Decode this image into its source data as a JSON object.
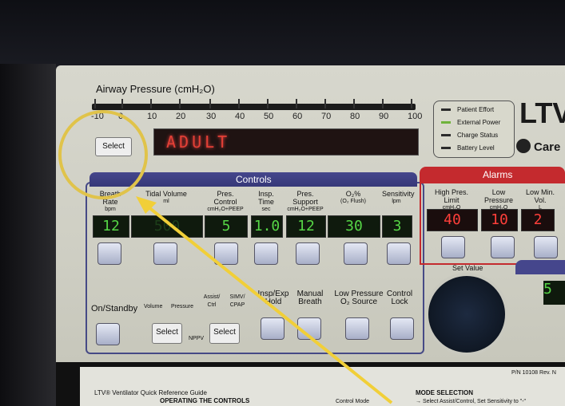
{
  "airway": {
    "title": "Airway Pressure (cmH₂O)",
    "scale": [
      "-10",
      "0",
      "10",
      "20",
      "30",
      "40",
      "50",
      "60",
      "70",
      "80",
      "90",
      "100"
    ]
  },
  "display_text": "ADULT",
  "select_label": "Select",
  "status": [
    "Patient Effort",
    "External Power",
    "Charge Status",
    "Battery Level"
  ],
  "brand": {
    "name": "LTV",
    "sub": "Care"
  },
  "sections": {
    "controls": "Controls",
    "alarms": "Alarms"
  },
  "controls": [
    {
      "label": "Breath Rate",
      "unit": "bpm",
      "value": "12"
    },
    {
      "label": "Tidal Volume",
      "unit": "ml",
      "value": "500"
    },
    {
      "label": "Pres. Control",
      "unit": "cmH₂O+PEEP",
      "value": "5"
    },
    {
      "label": "Insp. Time",
      "unit": "sec",
      "value": "1.0"
    },
    {
      "label": "Pres. Support",
      "unit": "cmH₂O+PEEP",
      "value": "12"
    },
    {
      "label": "O₂%",
      "unit": "(O₂ Flush)",
      "value": "30"
    },
    {
      "label": "Sensitivity",
      "unit": "lpm",
      "value": "3"
    }
  ],
  "alarms": [
    {
      "label": "High Pres. Limit",
      "unit": "cmH₂O",
      "value": "40"
    },
    {
      "label": "Low Pressure",
      "unit": "cmH₂O",
      "value": "10"
    },
    {
      "label": "Low Min. Vol.",
      "unit": "L",
      "value": "2"
    }
  ],
  "lower": {
    "on_standby": "On/Standby",
    "volume": "Volume",
    "pressure": "Pressure",
    "assist_ctrl": "Assist/ Ctrl",
    "simv_cpap": "SIMV/ CPAP",
    "nppv": "NPPV",
    "insp_exp": "Insp/Exp Hold",
    "manual": "Manual Breath",
    "low_pressure_o2": "Low Pressure O₂ Source",
    "control_lock": "Control Lock",
    "select": "Select"
  },
  "set_value": "Set Value",
  "right_partial_value": "5",
  "doc": {
    "guide": "LTV® Ventilator Quick Reference Guide",
    "operating": "OPERATING THE CONTROLS",
    "mode": "MODE SELECTION",
    "pn": "P/N 10108 Rev. N",
    "control_mode": "Control Mode",
    "select_ac": "→ Select Assist/Control, Set Sensitivity to \"-\""
  }
}
